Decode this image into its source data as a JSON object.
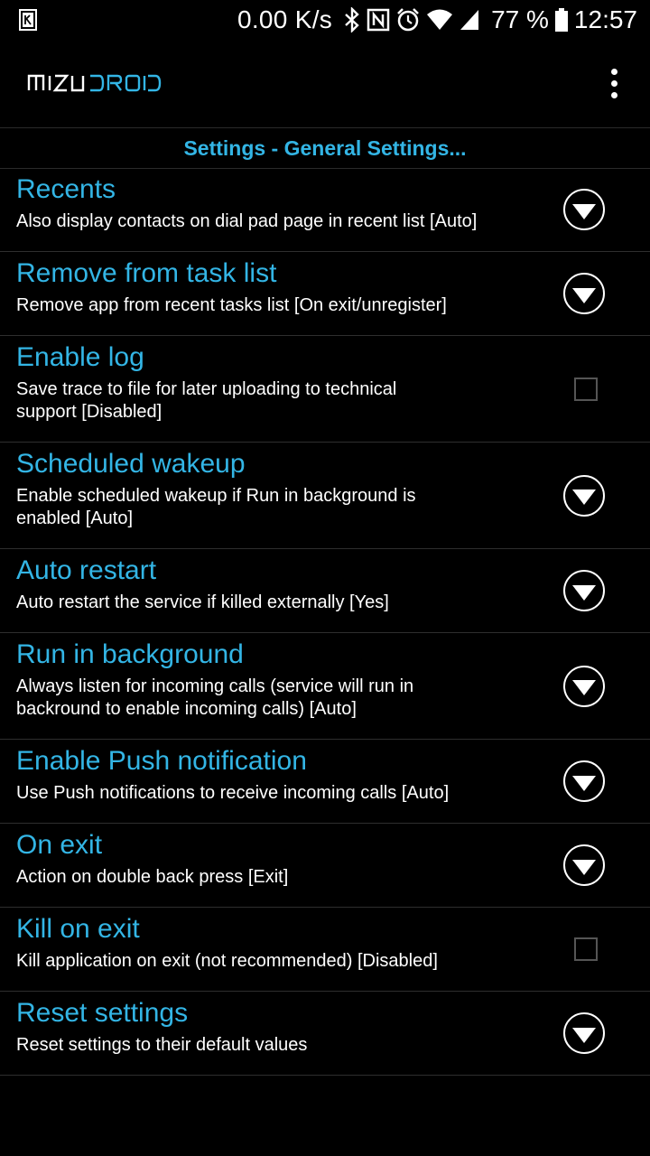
{
  "status_bar": {
    "speed": "0.00 K/s",
    "battery_percent": "77 %",
    "time": "12:57",
    "icons": [
      "keyboard-icon",
      "bluetooth-icon",
      "nfc-icon",
      "alarm-icon",
      "wifi-icon",
      "signal-icon",
      "battery-icon"
    ]
  },
  "app_bar": {
    "logo_text": "MIZUDROID",
    "menu_icon": "overflow-menu-icon"
  },
  "section_header": "Settings - General Settings...",
  "accent_color": "#33b5e5",
  "settings": [
    {
      "title": "Recents",
      "summary": "Also display contacts on dial pad page in recent list [Auto]",
      "control": "dropdown"
    },
    {
      "title": "Remove from task list",
      "summary": "Remove app from recent tasks list [On exit/unregister]",
      "control": "dropdown"
    },
    {
      "title": "Enable log",
      "summary": "Save trace to file for later uploading to technical support [Disabled]",
      "control": "checkbox",
      "checked": false
    },
    {
      "title": "Scheduled wakeup",
      "summary": "Enable scheduled wakeup if Run in background is enabled [Auto]",
      "control": "dropdown"
    },
    {
      "title": "Auto restart",
      "summary": "Auto restart the service if killed externally [Yes]",
      "control": "dropdown"
    },
    {
      "title": "Run in background",
      "summary": "Always listen for incoming calls (service will run in backround to enable incoming calls) [Auto]",
      "control": "dropdown"
    },
    {
      "title": "Enable Push notification",
      "summary": "Use Push notifications to receive incoming calls [Auto]",
      "control": "dropdown"
    },
    {
      "title": "On exit",
      "summary": "Action on double back press [Exit]",
      "control": "dropdown"
    },
    {
      "title": "Kill on exit",
      "summary": "Kill application on exit (not recommended) [Disabled]",
      "control": "checkbox",
      "checked": false
    },
    {
      "title": "Reset settings",
      "summary": "Reset settings to their default values",
      "control": "dropdown"
    }
  ]
}
